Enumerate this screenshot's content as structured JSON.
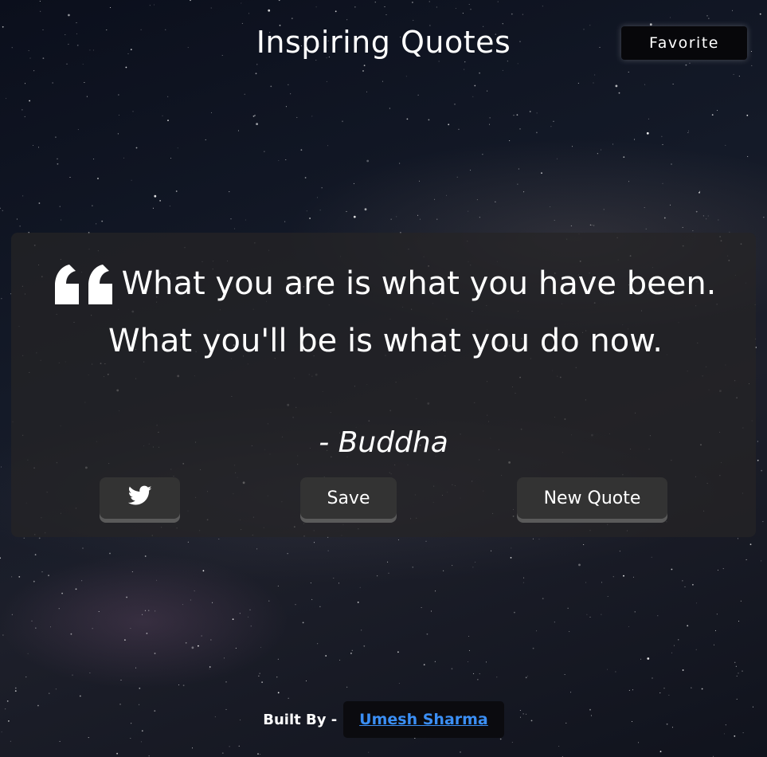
{
  "header": {
    "title": "Inspiring Quotes",
    "favorite_label": "Favorite"
  },
  "quote": {
    "icon": "quote-left-icon",
    "text": "What you are is what you have been. What you'll be is what you do now.",
    "author": "- Buddha"
  },
  "actions": {
    "twitter_icon": "twitter-icon",
    "save_label": "Save",
    "new_quote_label": "New Quote"
  },
  "footer": {
    "built_by_label": "Built By -",
    "author_name": "Umesh Sharma"
  },
  "colors": {
    "link": "#3b8ff5",
    "button_bg": "#333333",
    "card_bg": "rgba(38,36,38,0.72)"
  }
}
